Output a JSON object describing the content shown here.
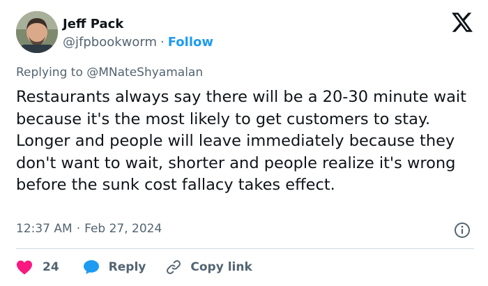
{
  "author": {
    "name": "Jeff Pack",
    "handle": "@jfpbookworm",
    "separator": "·",
    "follow_label": "Follow"
  },
  "reply_context": {
    "prefix": "Replying to",
    "mention": "@MNateShyamalan"
  },
  "tweet": {
    "text": "Restaurants always say there will be a 20-30 minute wait because it's the most likely to get customers to stay. Longer and people will leave immediately because they don't want to wait, shorter and people realize it's wrong before the sunk cost fallacy takes effect.",
    "time": "12:37 AM",
    "separator": "·",
    "date": "Feb 27, 2024"
  },
  "actions": {
    "like_count": "24",
    "reply_label": "Reply",
    "copy_label": "Copy link"
  },
  "icons": {
    "logo": "x-logo-icon",
    "info": "info-icon",
    "like": "heart-icon",
    "reply": "speech-bubble-icon",
    "copy": "link-icon"
  },
  "colors": {
    "text": "#0f1419",
    "secondary": "#536471",
    "accent": "#1d9bf0",
    "like": "#f91880",
    "divider": "#cfd9de"
  }
}
